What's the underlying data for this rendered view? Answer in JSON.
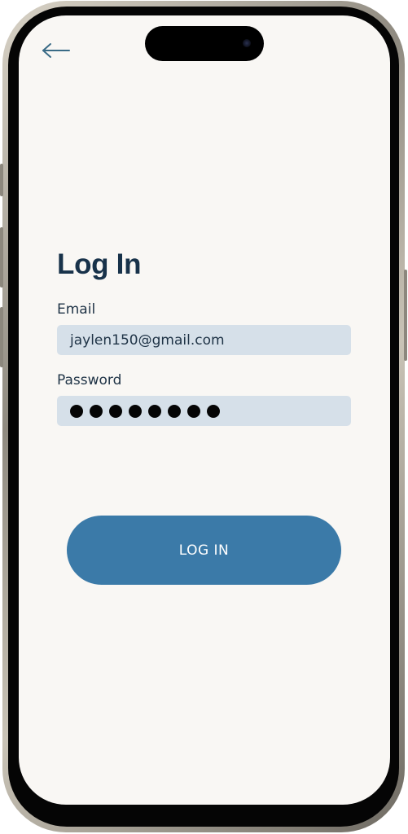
{
  "header": {
    "back_icon": "arrow-left-icon"
  },
  "login": {
    "title": "Log In",
    "email_label": "Email",
    "email_value": "jaylen150@gmail.com",
    "password_label": "Password",
    "password_masked_length": 8,
    "submit_label": "LOG IN"
  },
  "colors": {
    "accent": "#3b7aa8",
    "title": "#18324a",
    "field_bg": "#d6e0e9",
    "screen_bg": "#f9f7f4"
  }
}
